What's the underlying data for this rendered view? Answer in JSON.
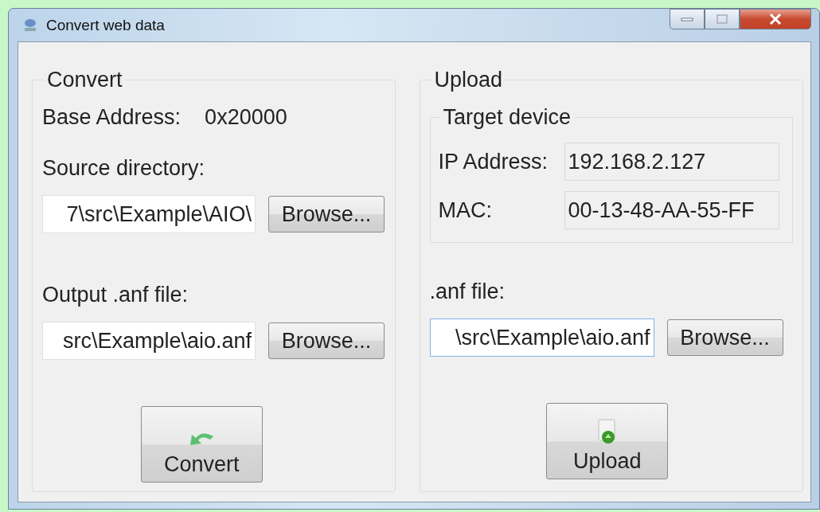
{
  "window": {
    "title": "Convert web data"
  },
  "convert": {
    "title": "Convert",
    "base_address_label": "Base Address:",
    "base_address": "0x20000",
    "source_label": "Source directory:",
    "source_value": "7\\src\\Example\\AIO\\",
    "source_browse": "Browse...",
    "output_label": "Output .anf file:",
    "output_value": "src\\Example\\aio.anf",
    "output_browse": "Browse...",
    "button": "Convert"
  },
  "upload": {
    "title": "Upload",
    "target": {
      "title": "Target device",
      "ip_label": "IP Address:",
      "ip": "192.168.2.127",
      "mac_label": "MAC:",
      "mac": "00-13-48-AA-55-FF"
    },
    "anf_label": ".anf file:",
    "anf_value": "\\src\\Example\\aio.anf",
    "anf_focused": true,
    "anf_browse": "Browse...",
    "button": "Upload"
  }
}
